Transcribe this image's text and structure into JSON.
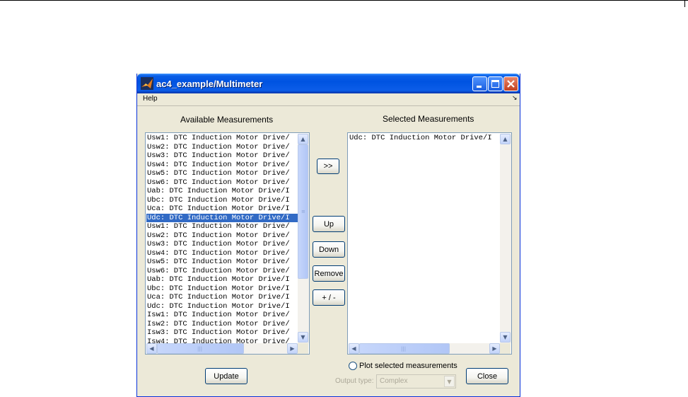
{
  "window": {
    "title": "ac4_example/Multimeter",
    "menu": {
      "help": "Help",
      "dock_icon": "dock-arrow-icon"
    }
  },
  "available": {
    "heading": "Available Measurements",
    "items": [
      "Usw1: DTC Induction Motor Drive/",
      "Usw2: DTC Induction Motor Drive/",
      "Usw3: DTC Induction Motor Drive/",
      "Usw4: DTC Induction Motor Drive/",
      "Usw5: DTC Induction Motor Drive/",
      "Usw6: DTC Induction Motor Drive/",
      "Uab: DTC Induction Motor Drive/I",
      "Ubc: DTC Induction Motor Drive/I",
      "Uca: DTC Induction Motor Drive/I",
      "Udc: DTC Induction Motor Drive/I",
      "Usw1: DTC Induction Motor Drive/",
      "Usw2: DTC Induction Motor Drive/",
      "Usw3: DTC Induction Motor Drive/",
      "Usw4: DTC Induction Motor Drive/",
      "Usw5: DTC Induction Motor Drive/",
      "Usw6: DTC Induction Motor Drive/",
      "Uab: DTC Induction Motor Drive/I",
      "Ubc: DTC Induction Motor Drive/I",
      "Uca: DTC Induction Motor Drive/I",
      "Udc: DTC Induction Motor Drive/I",
      "Isw1: DTC Induction Motor Drive/",
      "Isw2: DTC Induction Motor Drive/",
      "Isw3: DTC Induction Motor Drive/",
      "Isw4: DTC Induction Motor Drive/"
    ],
    "selected_index": 9
  },
  "selected": {
    "heading": "Selected Measurements",
    "items": [
      "Udc: DTC Induction Motor Drive/I"
    ]
  },
  "buttons": {
    "add": ">>",
    "up": "Up",
    "down": "Down",
    "remove": "Remove",
    "sign": "+ / -",
    "update": "Update",
    "close": "Close"
  },
  "plot": {
    "label": "Plot selected measurements",
    "checked": false
  },
  "output_type": {
    "label": "Output type:",
    "value": "Complex",
    "enabled": false
  },
  "colors": {
    "titlebar": "#0053e1",
    "selection": "#316ac5",
    "dialog_bg": "#ece9d8"
  }
}
